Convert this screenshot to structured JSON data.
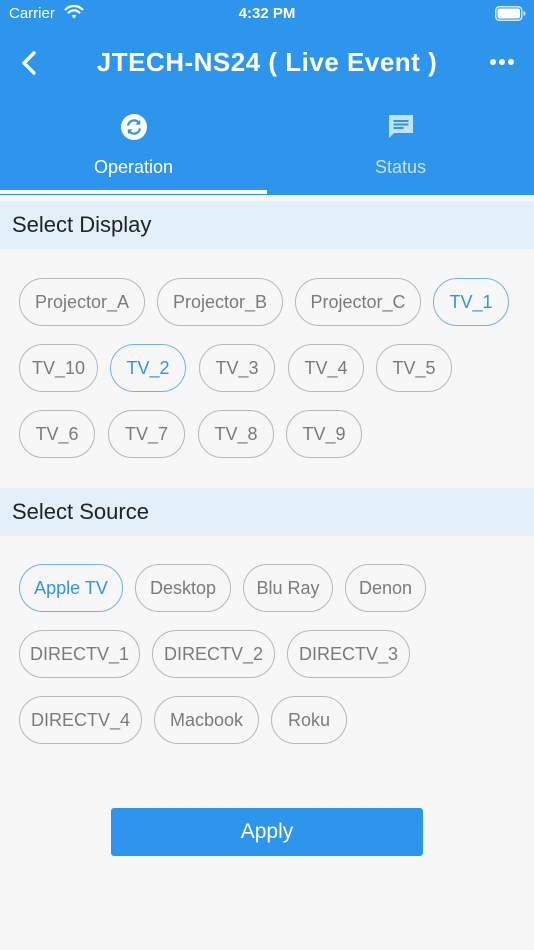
{
  "status_bar": {
    "carrier": "Carrier",
    "time": "4:32 PM"
  },
  "nav": {
    "title": "JTECH-NS24 ( Live Event )"
  },
  "tabs": [
    {
      "label": "Operation",
      "icon": "refresh-icon",
      "active": true
    },
    {
      "label": "Status",
      "icon": "message-icon",
      "active": false
    }
  ],
  "display_section": {
    "title": "Select Display",
    "items": [
      "Projector_A",
      "Projector_B",
      "Projector_C",
      "TV_1",
      "TV_10",
      "TV_2",
      "TV_3",
      "TV_4",
      "TV_5",
      "TV_6",
      "TV_7",
      "TV_8",
      "TV_9"
    ],
    "selected": [
      "TV_1",
      "TV_2"
    ]
  },
  "source_section": {
    "title": "Select Source",
    "items": [
      "Apple TV",
      "Desktop",
      "Blu Ray",
      "Denon",
      "DIRECTV_1",
      "DIRECTV_2",
      "DIRECTV_3",
      "DIRECTV_4",
      "Macbook",
      "Roku"
    ],
    "selected": [
      "Apple TV"
    ]
  },
  "apply_label": "Apply",
  "colors": {
    "primary": "#2e95ec",
    "section_bg": "#e3eff9",
    "page_bg": "#f7f7f7",
    "chip_border": "#b7b7b7",
    "chip_text": "#7b7b7b"
  }
}
